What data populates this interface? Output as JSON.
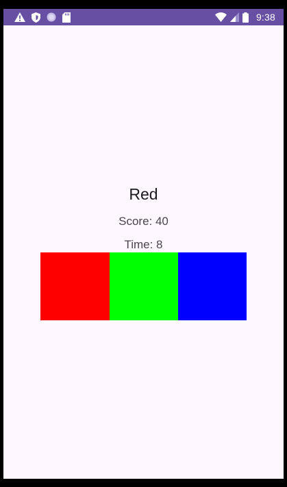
{
  "status_bar": {
    "time": "9:38",
    "icons": [
      "warning-icon",
      "shield-icon",
      "circle-icon",
      "sd-card-icon",
      "wifi-icon",
      "signal-icon",
      "battery-icon"
    ]
  },
  "game": {
    "color_word": "Red",
    "score_text": "Score: 40",
    "time_text": "Time: 8"
  },
  "color_boxes": [
    {
      "name": "red",
      "color": "#ff0000"
    },
    {
      "name": "green",
      "color": "#00ff00"
    },
    {
      "name": "blue",
      "color": "#0000ff"
    }
  ],
  "theme": {
    "status_bar_color": "#6750a4",
    "background": "#fef7ff"
  }
}
